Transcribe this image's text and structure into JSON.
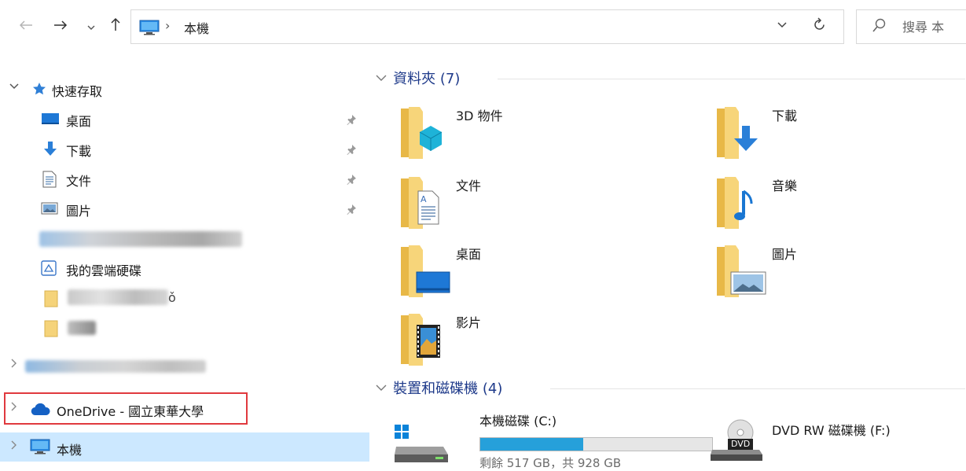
{
  "address": {
    "location": "本機",
    "separator": "›"
  },
  "search": {
    "placeholder": "搜尋 本"
  },
  "nav": {
    "quick_access_label": "快速存取",
    "pinned": [
      {
        "label": "桌面",
        "icon": "desktop-icon"
      },
      {
        "label": "下載",
        "icon": "download-icon"
      },
      {
        "label": "文件",
        "icon": "document-icon"
      },
      {
        "label": "圖片",
        "icon": "pictures-icon"
      }
    ],
    "cloud_drive_label": "我的雲端硬碟",
    "partial_folder_suffix": "ǒ",
    "onedrive_label": "OneDrive - 國立東華大學",
    "this_pc_label": "本機"
  },
  "folders_group": {
    "header": "資料夾 (7)",
    "items": [
      {
        "label": "3D 物件",
        "icon": "3d-objects-folder-icon"
      },
      {
        "label": "下載",
        "icon": "downloads-folder-icon"
      },
      {
        "label": "文件",
        "icon": "documents-folder-icon"
      },
      {
        "label": "音樂",
        "icon": "music-folder-icon"
      },
      {
        "label": "桌面",
        "icon": "desktop-folder-icon"
      },
      {
        "label": "圖片",
        "icon": "pictures-folder-icon"
      },
      {
        "label": "影片",
        "icon": "videos-folder-icon"
      }
    ]
  },
  "drives_group": {
    "header": "裝置和磁碟機 (4)",
    "local_disk": {
      "label": "本機磁碟 (C:)",
      "info": "剩餘 517 GB，共 928 GB",
      "used_fraction": 0.443
    },
    "dvd": {
      "label": "DVD RW 磁碟機 (F:)",
      "badge": "DVD"
    }
  },
  "colors": {
    "selection": "#cce8ff",
    "highlight_border": "#e0393e",
    "group_header": "#1e3a8a",
    "bar_fill": "#26a0da"
  }
}
